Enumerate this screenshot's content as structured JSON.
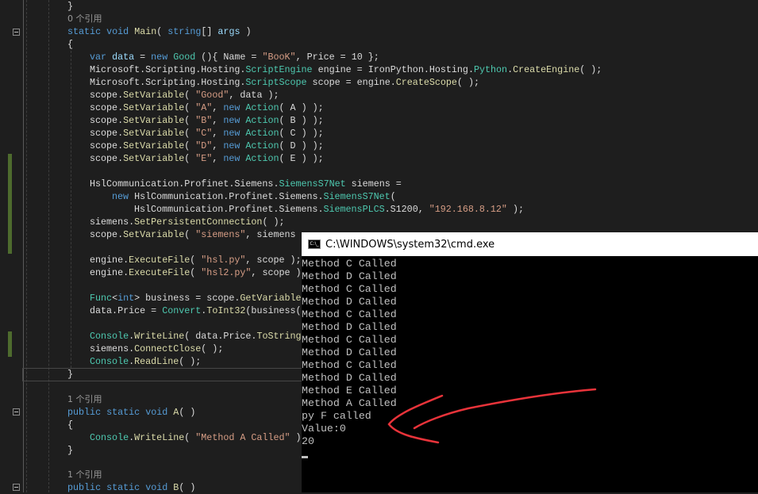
{
  "editor": {
    "lines": [
      {
        "indent": 2,
        "tokens": [
          [
            "}",
            ""
          ]
        ]
      },
      {
        "indent": 2,
        "lens": true,
        "tokens": [
          [
            "0 个引用",
            "lens"
          ]
        ]
      },
      {
        "indent": 2,
        "tokens": [
          [
            "static ",
            "kw"
          ],
          [
            "void ",
            "kw"
          ],
          [
            "Main",
            "fn"
          ],
          [
            "( ",
            ""
          ],
          [
            "string",
            "kw"
          ],
          [
            "[] ",
            ""
          ],
          [
            "args",
            "id"
          ],
          [
            " )",
            ""
          ]
        ]
      },
      {
        "indent": 2,
        "tokens": [
          [
            "{",
            ""
          ]
        ]
      },
      {
        "indent": 3,
        "tokens": [
          [
            "var ",
            "kw"
          ],
          [
            "data",
            "id"
          ],
          [
            " = ",
            ""
          ],
          [
            "new ",
            "kw"
          ],
          [
            "Good",
            "ty"
          ],
          [
            " (){ Name = ",
            ""
          ],
          [
            "\"BooK\"",
            "st"
          ],
          [
            ", Price = 10 };",
            ""
          ]
        ]
      },
      {
        "indent": 3,
        "tokens": [
          [
            "Microsoft.Scripting.Hosting.",
            ""
          ],
          [
            "ScriptEngine",
            "ty"
          ],
          [
            " engine = IronPython.Hosting.",
            ""
          ],
          [
            "Python",
            "ty"
          ],
          [
            ".",
            ""
          ],
          [
            "CreateEngine",
            "fn"
          ],
          [
            "( );",
            ""
          ]
        ]
      },
      {
        "indent": 3,
        "tokens": [
          [
            "Microsoft.Scripting.Hosting.",
            ""
          ],
          [
            "ScriptScope",
            "ty"
          ],
          [
            " scope = engine.",
            ""
          ],
          [
            "CreateScope",
            "fn"
          ],
          [
            "( );",
            ""
          ]
        ]
      },
      {
        "indent": 3,
        "tokens": [
          [
            "scope.",
            ""
          ],
          [
            "SetVariable",
            "fn"
          ],
          [
            "( ",
            ""
          ],
          [
            "\"Good\"",
            "st"
          ],
          [
            ", data );",
            ""
          ]
        ]
      },
      {
        "indent": 3,
        "tokens": [
          [
            "scope.",
            ""
          ],
          [
            "SetVariable",
            "fn"
          ],
          [
            "( ",
            ""
          ],
          [
            "\"A\"",
            "st"
          ],
          [
            ", ",
            ""
          ],
          [
            "new ",
            "kw"
          ],
          [
            "Action",
            "ty"
          ],
          [
            "( A ) );",
            ""
          ]
        ]
      },
      {
        "indent": 3,
        "tokens": [
          [
            "scope.",
            ""
          ],
          [
            "SetVariable",
            "fn"
          ],
          [
            "( ",
            ""
          ],
          [
            "\"B\"",
            "st"
          ],
          [
            ", ",
            ""
          ],
          [
            "new ",
            "kw"
          ],
          [
            "Action",
            "ty"
          ],
          [
            "( B ) );",
            ""
          ]
        ]
      },
      {
        "indent": 3,
        "tokens": [
          [
            "scope.",
            ""
          ],
          [
            "SetVariable",
            "fn"
          ],
          [
            "( ",
            ""
          ],
          [
            "\"C\"",
            "st"
          ],
          [
            ", ",
            ""
          ],
          [
            "new ",
            "kw"
          ],
          [
            "Action",
            "ty"
          ],
          [
            "( C ) );",
            ""
          ]
        ]
      },
      {
        "indent": 3,
        "tokens": [
          [
            "scope.",
            ""
          ],
          [
            "SetVariable",
            "fn"
          ],
          [
            "( ",
            ""
          ],
          [
            "\"D\"",
            "st"
          ],
          [
            ", ",
            ""
          ],
          [
            "new ",
            "kw"
          ],
          [
            "Action",
            "ty"
          ],
          [
            "( D ) );",
            ""
          ]
        ]
      },
      {
        "indent": 3,
        "tokens": [
          [
            "scope.",
            ""
          ],
          [
            "SetVariable",
            "fn"
          ],
          [
            "( ",
            ""
          ],
          [
            "\"E\"",
            "st"
          ],
          [
            ", ",
            ""
          ],
          [
            "new ",
            "kw"
          ],
          [
            "Action",
            "ty"
          ],
          [
            "( E ) );",
            ""
          ]
        ]
      },
      {
        "indent": 3,
        "tokens": []
      },
      {
        "indent": 3,
        "tokens": [
          [
            "HslCommunication.Profinet.Siemens.",
            ""
          ],
          [
            "SiemensS7Net",
            "ty"
          ],
          [
            " siemens =",
            ""
          ]
        ]
      },
      {
        "indent": 4,
        "tokens": [
          [
            "new ",
            "kw"
          ],
          [
            "HslCommunication.Profinet.Siemens.",
            ""
          ],
          [
            "SiemensS7Net",
            "ty"
          ],
          [
            "(",
            ""
          ]
        ]
      },
      {
        "indent": 5,
        "tokens": [
          [
            "HslCommunication.Profinet.Siemens.",
            ""
          ],
          [
            "SiemensPLCS",
            "ty"
          ],
          [
            ".S1200, ",
            ""
          ],
          [
            "\"192.168.8.12\"",
            "st"
          ],
          [
            " );",
            ""
          ]
        ]
      },
      {
        "indent": 3,
        "tokens": [
          [
            "siemens.",
            ""
          ],
          [
            "SetPersistentConnection",
            "fn"
          ],
          [
            "( );",
            ""
          ]
        ]
      },
      {
        "indent": 3,
        "tokens": [
          [
            "scope.",
            ""
          ],
          [
            "SetVariable",
            "fn"
          ],
          [
            "( ",
            ""
          ],
          [
            "\"siemens\"",
            "st"
          ],
          [
            ", siemens",
            ""
          ]
        ]
      },
      {
        "indent": 3,
        "tokens": []
      },
      {
        "indent": 3,
        "tokens": [
          [
            "engine.",
            ""
          ],
          [
            "ExecuteFile",
            "fn"
          ],
          [
            "( ",
            ""
          ],
          [
            "\"hsl.py\"",
            "st"
          ],
          [
            ", scope );",
            ""
          ]
        ]
      },
      {
        "indent": 3,
        "tokens": [
          [
            "engine.",
            ""
          ],
          [
            "ExecuteFile",
            "fn"
          ],
          [
            "( ",
            ""
          ],
          [
            "\"hsl2.py\"",
            "st"
          ],
          [
            ", scope )",
            ""
          ]
        ]
      },
      {
        "indent": 3,
        "tokens": []
      },
      {
        "indent": 3,
        "tokens": [
          [
            "Func",
            "ty"
          ],
          [
            "<",
            ""
          ],
          [
            "int",
            "kw"
          ],
          [
            "> business = scope.",
            ""
          ],
          [
            "GetVariable",
            "fn"
          ]
        ]
      },
      {
        "indent": 3,
        "tokens": [
          [
            "data.Price = ",
            ""
          ],
          [
            "Convert",
            "ty"
          ],
          [
            ".",
            ""
          ],
          [
            "ToInt32",
            "fn"
          ],
          [
            "(business(",
            ""
          ]
        ]
      },
      {
        "indent": 3,
        "tokens": []
      },
      {
        "indent": 3,
        "tokens": [
          [
            "Console",
            "ty"
          ],
          [
            ".",
            ""
          ],
          [
            "WriteLine",
            "fn"
          ],
          [
            "( data.Price.",
            ""
          ],
          [
            "ToString",
            "fn"
          ]
        ]
      },
      {
        "indent": 3,
        "tokens": [
          [
            "siemens.",
            ""
          ],
          [
            "ConnectClose",
            "fn"
          ],
          [
            "( );",
            ""
          ]
        ]
      },
      {
        "indent": 3,
        "tokens": [
          [
            "Console",
            "ty"
          ],
          [
            ".",
            ""
          ],
          [
            "ReadLine",
            "fn"
          ],
          [
            "( );",
            ""
          ]
        ]
      },
      {
        "indent": 2,
        "tokens": [
          [
            "}",
            ""
          ]
        ]
      },
      {
        "indent": 2,
        "tokens": []
      },
      {
        "indent": 2,
        "lens": true,
        "tokens": [
          [
            "1 个引用",
            "lens"
          ]
        ]
      },
      {
        "indent": 2,
        "tokens": [
          [
            "public ",
            "kw"
          ],
          [
            "static ",
            "kw"
          ],
          [
            "void ",
            "kw"
          ],
          [
            "A",
            "fn"
          ],
          [
            "( )",
            ""
          ]
        ]
      },
      {
        "indent": 2,
        "tokens": [
          [
            "{",
            ""
          ]
        ]
      },
      {
        "indent": 3,
        "tokens": [
          [
            "Console",
            "ty"
          ],
          [
            ".",
            ""
          ],
          [
            "WriteLine",
            "fn"
          ],
          [
            "( ",
            ""
          ],
          [
            "\"Method A Called\"",
            "st"
          ],
          [
            " )",
            ""
          ]
        ]
      },
      {
        "indent": 2,
        "tokens": [
          [
            "}",
            ""
          ]
        ]
      },
      {
        "indent": 2,
        "tokens": []
      },
      {
        "indent": 2,
        "lens": true,
        "tokens": [
          [
            "1 个引用",
            "lens"
          ]
        ]
      },
      {
        "indent": 2,
        "tokens": [
          [
            "public ",
            "kw"
          ],
          [
            "static ",
            "kw"
          ],
          [
            "void ",
            "kw"
          ],
          [
            "B",
            "fn"
          ],
          [
            "( )",
            ""
          ]
        ]
      }
    ]
  },
  "cmd": {
    "title": "C:\\WINDOWS\\system32\\cmd.exe",
    "icon": "console-icon",
    "icon_text": "C:\\_",
    "output": [
      "Method C Called",
      "Method D Called",
      "Method C Called",
      "Method D Called",
      "Method C Called",
      "Method D Called",
      "Method C Called",
      "Method D Called",
      "Method C Called",
      "Method D Called",
      "Method E Called",
      "Method A Called",
      "py F called",
      "Value:0",
      "20"
    ]
  },
  "annotation": {
    "color": "#e8333a",
    "icon": "red-arrow-annotation"
  }
}
